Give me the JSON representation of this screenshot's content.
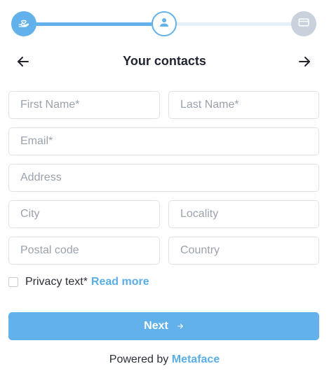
{
  "stepper": {
    "steps": [
      {
        "icon": "hand-heart-icon",
        "state": "done"
      },
      {
        "icon": "user-icon",
        "state": "current"
      },
      {
        "icon": "credit-card-icon",
        "state": "upcoming"
      }
    ],
    "colors": {
      "active": "#62b1ea",
      "inactive": "#c9d1dc",
      "track": "#e6eef6"
    }
  },
  "header": {
    "title": "Your contacts",
    "back_icon": "arrow-left-icon",
    "forward_icon": "arrow-right-icon"
  },
  "form": {
    "first_name": {
      "placeholder": "First Name*",
      "value": ""
    },
    "last_name": {
      "placeholder": "Last Name*",
      "value": ""
    },
    "email": {
      "placeholder": "Email*",
      "value": ""
    },
    "address": {
      "placeholder": "Address",
      "value": ""
    },
    "city": {
      "placeholder": "City",
      "value": ""
    },
    "locality": {
      "placeholder": "Locality",
      "value": ""
    },
    "postal_code": {
      "placeholder": "Postal code",
      "value": ""
    },
    "country": {
      "placeholder": "Country",
      "value": ""
    }
  },
  "privacy": {
    "text": "Privacy text*",
    "link": "Read more",
    "checked": false
  },
  "next_button": {
    "label": "Next",
    "icon": "arrow-right-icon"
  },
  "footer": {
    "powered_by": "Powered by",
    "brand": "Metaface"
  },
  "theme": {
    "accent": "#62b1ea",
    "link": "#5aaee6",
    "text": "#1f2430",
    "border": "#dfe3e8",
    "placeholder": "#9aa2ad"
  }
}
